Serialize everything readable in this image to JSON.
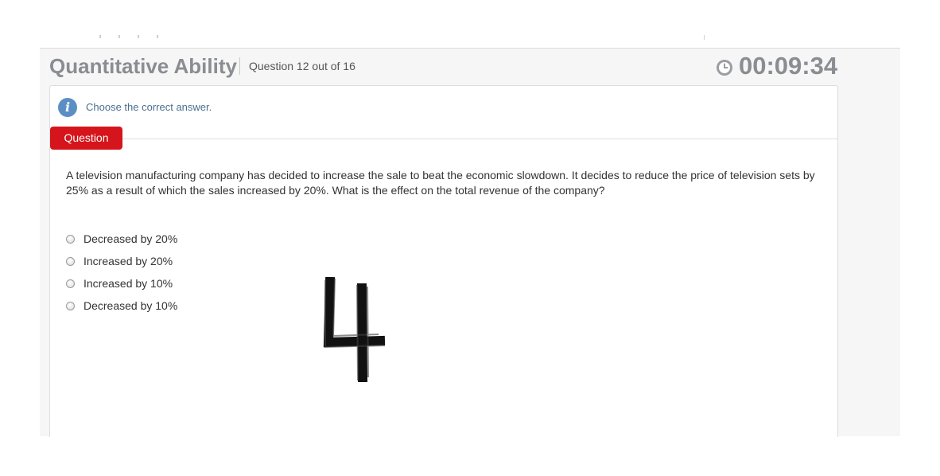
{
  "header": {
    "title": "Quantitative Ability",
    "question_counter": "Question 12 out of 16",
    "timer": "00:09:34",
    "timer_icon": "clock-icon"
  },
  "instruction": {
    "icon": "info-icon",
    "icon_glyph": "i",
    "text": "Choose the correct answer."
  },
  "question": {
    "tab_label": "Question",
    "text": "A television manufacturing company has decided to increase the sale to beat the economic slowdown. It decides to reduce the price of television sets by 25% as a result of which the sales increased by 20%. What is the effect on the total revenue of the company?"
  },
  "options": [
    {
      "label": "Decreased by 20%",
      "selected": false
    },
    {
      "label": "Increased by 20%",
      "selected": false
    },
    {
      "label": "Increased by 10%",
      "selected": false
    },
    {
      "label": "Decreased by 10%",
      "selected": false
    }
  ],
  "colors": {
    "accent_red": "#d6141b",
    "header_gray": "#8a8d92",
    "info_blue": "#5b8fc4"
  }
}
